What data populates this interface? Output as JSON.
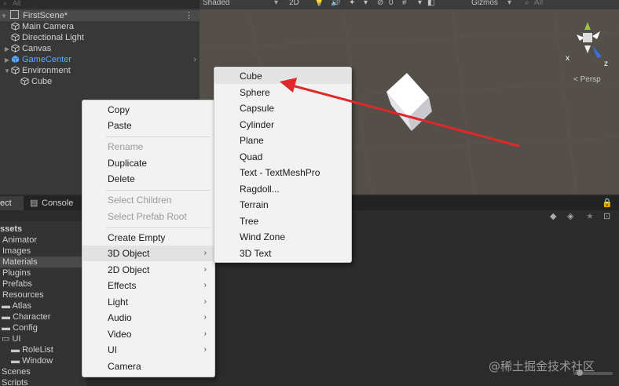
{
  "hierarchy": {
    "search_placeholder": "All",
    "scene_name": "FirstScene*",
    "items": [
      {
        "label": "Main Camera"
      },
      {
        "label": "Directional Light"
      },
      {
        "label": "Canvas"
      },
      {
        "label": "GameCenter"
      },
      {
        "label": "Environment"
      },
      {
        "label": "Cube"
      }
    ]
  },
  "scene_toolbar": {
    "shading": "Shaded",
    "mode_2d": "2D",
    "hidden_count": "0",
    "gizmos": "Gizmos",
    "search_placeholder": "All"
  },
  "gizmo": {
    "x_label": "x",
    "z_label": "z",
    "persp_label": "< Persp"
  },
  "bottom_tabs": {
    "project": "ect",
    "console": "Console"
  },
  "project_tree": [
    {
      "label": "ssets"
    },
    {
      "label": "Animator"
    },
    {
      "label": "Images"
    },
    {
      "label": "Materials"
    },
    {
      "label": "Plugins"
    },
    {
      "label": "Prefabs"
    },
    {
      "label": "Resources"
    },
    {
      "label": "Atlas"
    },
    {
      "label": "Character"
    },
    {
      "label": "Config"
    },
    {
      "label": "UI"
    },
    {
      "label": "RoleList"
    },
    {
      "label": "Window"
    },
    {
      "label": "Scenes"
    },
    {
      "label": "Scripts"
    }
  ],
  "context_menu": {
    "items": [
      {
        "label": "Copy"
      },
      {
        "label": "Paste"
      },
      {
        "label": "Rename"
      },
      {
        "label": "Duplicate"
      },
      {
        "label": "Delete"
      },
      {
        "label": "Select Children"
      },
      {
        "label": "Select Prefab Root"
      },
      {
        "label": "Create Empty"
      },
      {
        "label": "3D Object"
      },
      {
        "label": "2D Object"
      },
      {
        "label": "Effects"
      },
      {
        "label": "Light"
      },
      {
        "label": "Audio"
      },
      {
        "label": "Video"
      },
      {
        "label": "UI"
      },
      {
        "label": "Camera"
      }
    ],
    "submenu_arrow": "›"
  },
  "submenu_3d_object": {
    "items": [
      {
        "label": "Cube"
      },
      {
        "label": "Sphere"
      },
      {
        "label": "Capsule"
      },
      {
        "label": "Cylinder"
      },
      {
        "label": "Plane"
      },
      {
        "label": "Quad"
      },
      {
        "label": "Text - TextMeshPro"
      },
      {
        "label": "Ragdoll..."
      },
      {
        "label": "Terrain"
      },
      {
        "label": "Tree"
      },
      {
        "label": "Wind Zone"
      },
      {
        "label": "3D Text"
      }
    ]
  },
  "watermark": "@稀土掘金技术社区",
  "colors": {
    "annotation_arrow": "#e0282a",
    "prefab_blue": "#5aa9ff",
    "menu_bg": "#f2f2f2"
  }
}
